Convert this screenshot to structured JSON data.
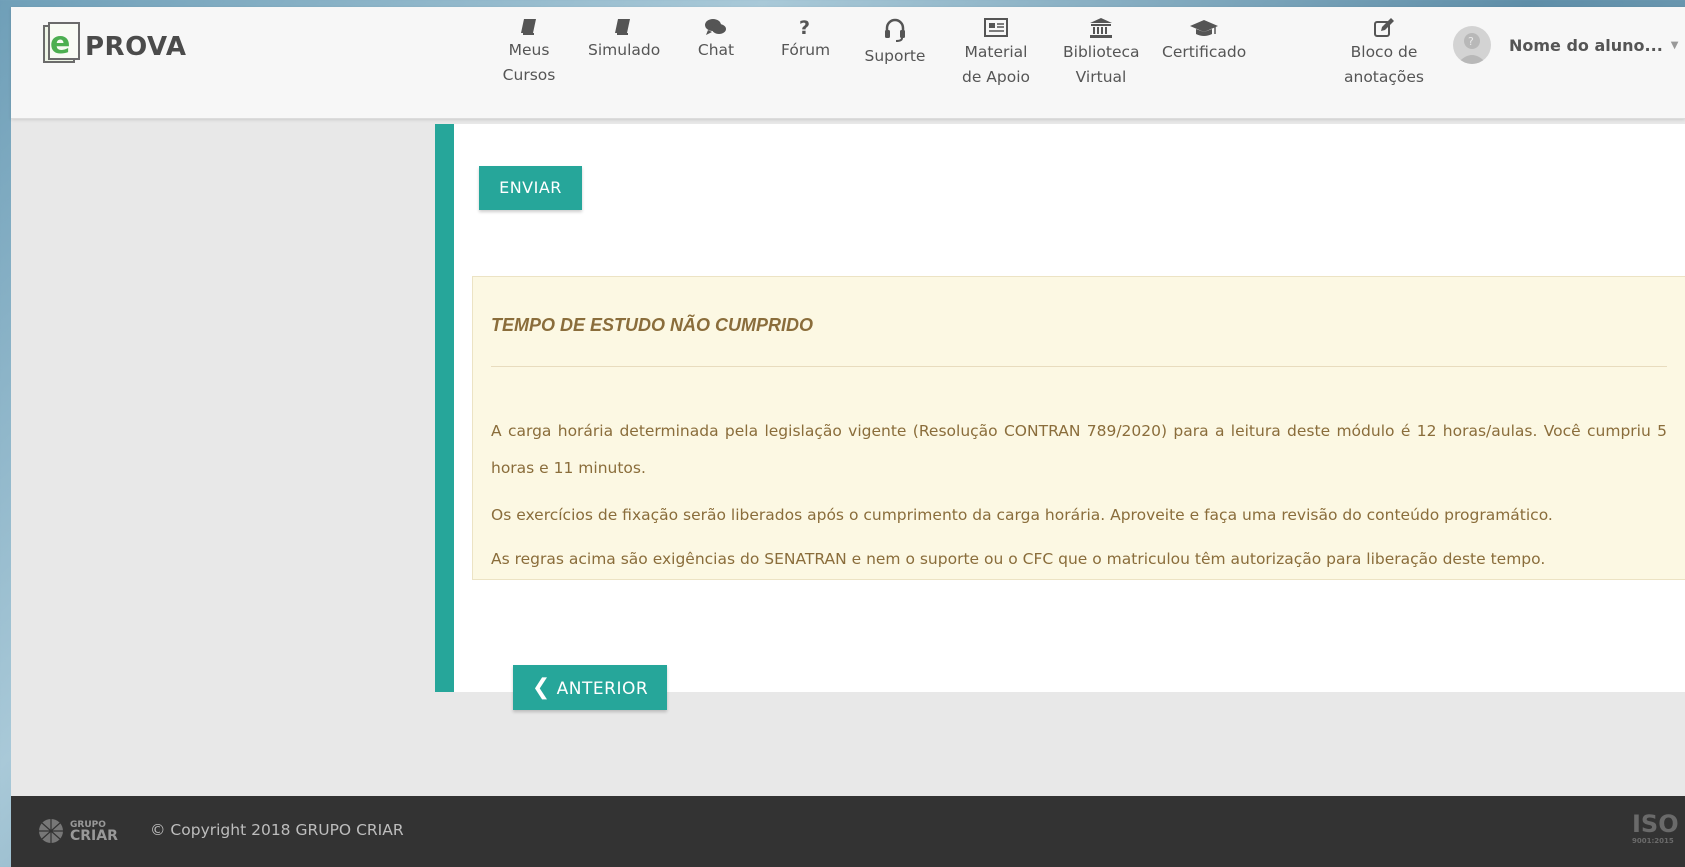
{
  "brand": {
    "logo_text": "PROVA",
    "logo_letter": "e"
  },
  "nav": [
    {
      "label": "Meus Cursos",
      "icon": "book-icon"
    },
    {
      "label": "Simulado",
      "icon": "book-icon"
    },
    {
      "label": "Chat",
      "icon": "chat-bubbles-icon"
    },
    {
      "label": "Fórum",
      "icon": "question-mark-icon"
    },
    {
      "label": "Suporte",
      "icon": "headset-icon"
    },
    {
      "label": "Material de Apoio",
      "icon": "newspaper-icon"
    },
    {
      "label": "Biblioteca Virtual",
      "icon": "library-icon"
    },
    {
      "label": "Certificado",
      "icon": "graduation-cap-icon"
    },
    {
      "label": "Bloco de anotações",
      "icon": "edit-note-icon"
    }
  ],
  "user": {
    "name": "Nome do aluno...",
    "avatar_icon": "user-avatar-icon"
  },
  "actions": {
    "submit_label": "ENVIAR",
    "previous_label": "ANTERIOR"
  },
  "warning": {
    "title": "TEMPO DE ESTUDO NÃO CUMPRIDO",
    "p1": "A carga horária determinada pela legislação vigente (Resolução CONTRAN 789/2020) para a leitura deste módulo é 12 horas/aulas. Você cumpriu 5 horas e 11 minutos.",
    "p2": "Os exercícios de fixação serão liberados após o cumprimento da carga horária. Aproveite e faça uma revisão do conteúdo programático.",
    "p3": "As regras acima são exigências do SENATRAN e nem o suporte ou o CFC que o matriculou têm autorização para liberação deste tempo."
  },
  "footer": {
    "brand_top": "GRUPO",
    "brand_bottom": "CRIAR",
    "copyright": "© Copyright 2018 GRUPO CRIAR",
    "iso_text": "ISO",
    "iso_sub": "9001:2015"
  },
  "colors": {
    "accent": "#26a69a",
    "warning_bg": "#fcf8e3",
    "warning_text": "#8a6d3b",
    "footer_bg": "#333333"
  }
}
